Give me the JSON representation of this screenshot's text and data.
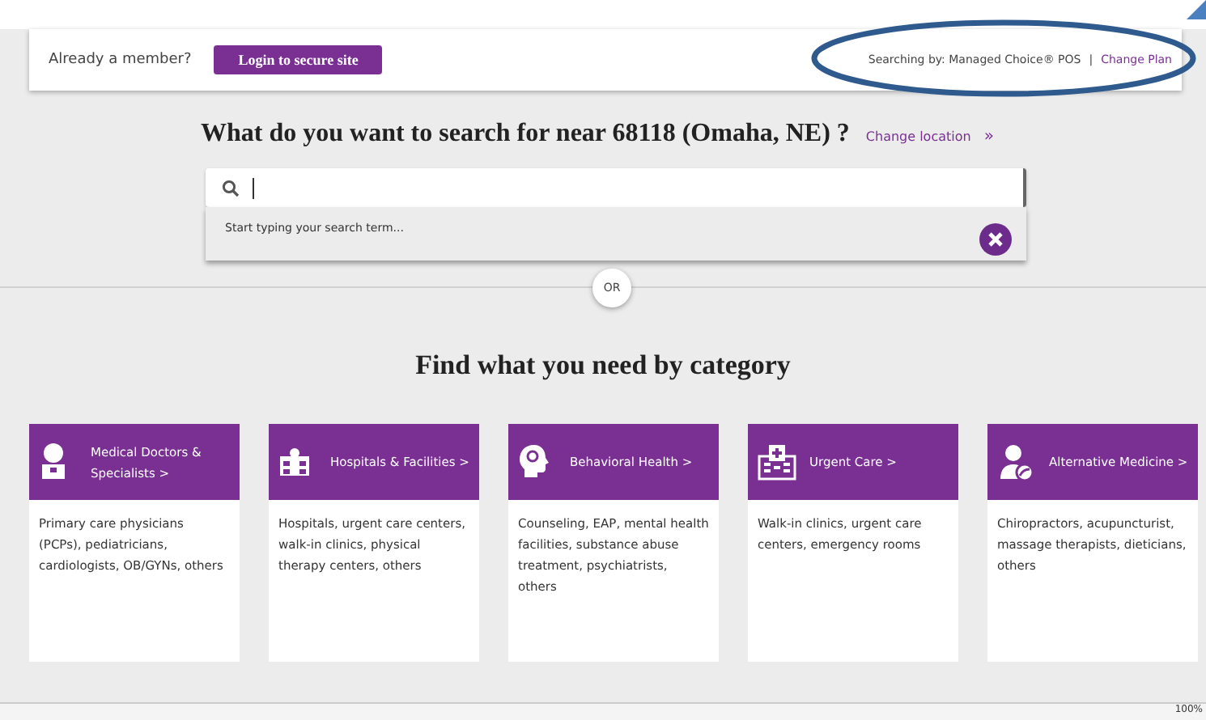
{
  "member_bar": {
    "prompt": "Already a member?",
    "login_button": "Login to secure site",
    "searching_by": "Searching by: Managed Choice® POS",
    "separator": "|",
    "change_plan": "Change Plan"
  },
  "search": {
    "heading": "What do you want to search for near 68118 (Omaha, NE) ?",
    "change_location": "Change location",
    "chevron": "»",
    "suggestion_hint": "Start typing your search term..."
  },
  "divider_label": "OR",
  "categories_heading": "Find what you need by category",
  "categories": [
    {
      "kind": "doctor",
      "title": "Medical Doctors & Specialists",
      "chevron": ">",
      "description": "Primary care physicians (PCPs), pediatricians, cardiologists, OB/GYNs, others"
    },
    {
      "kind": "building",
      "title": "Hospitals & Facilities",
      "chevron": ">",
      "description": "Hospitals, urgent care centers, walk-in clinics, physical therapy centers, others"
    },
    {
      "kind": "head",
      "title": "Behavioral Health",
      "chevron": ">",
      "description": "Counseling, EAP, mental health facilities, substance abuse treatment, psychiatrists, others"
    },
    {
      "kind": "hospital",
      "title": "Urgent Care",
      "chevron": ">",
      "description": "Walk-in clinics, urgent care centers, emergency rooms"
    },
    {
      "kind": "practitioner",
      "title": "Alternative Medicine",
      "chevron": ">",
      "description": "Chiropractors, acupuncturist, massage therapists, dieticians, others"
    }
  ],
  "status_bar": {
    "zoom": "100%"
  }
}
